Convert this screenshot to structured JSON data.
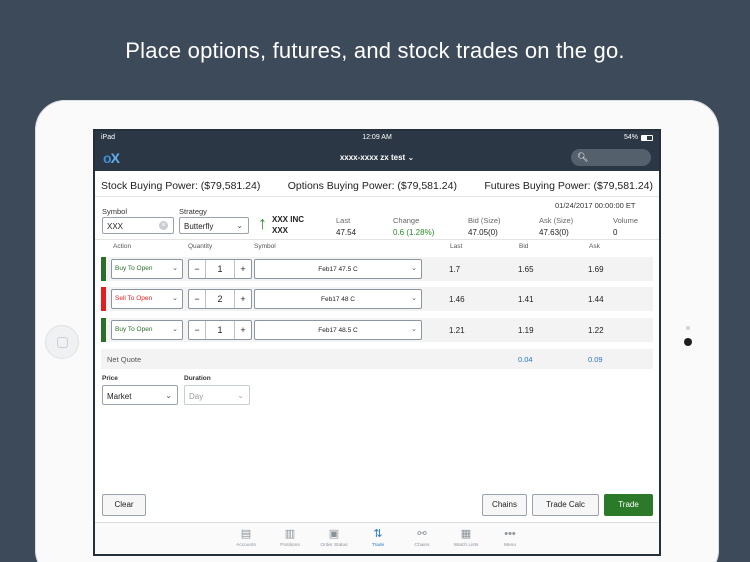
{
  "headline": "Place options, futures, and stock trades on the go.",
  "statusbar": {
    "device": "iPad",
    "time": "12:09 AM",
    "battery": "54%"
  },
  "navbar": {
    "logo_o": "o",
    "logo_x": "X",
    "account": "xxxx-xxxx zx test"
  },
  "buying_power": {
    "stock": "Stock Buying Power: ($79,581.24)",
    "options": "Options Buying Power: ($79,581.24)",
    "futures": "Futures Buying Power: ($79,581.24)"
  },
  "order": {
    "symbol_label": "Symbol",
    "symbol_value": "XXX",
    "strategy_label": "Strategy",
    "strategy_value": "Butterfly"
  },
  "quote": {
    "timestamp": "01/24/2017 00:00:00 ET",
    "name_line1": "XXX INC",
    "name_line2": "XXX",
    "last_label": "Last",
    "last_value": "47.54",
    "change_label": "Change",
    "change_value": "0.6 (1.28%)",
    "bid_label": "Bid (Size)",
    "bid_value": "47.05(0)",
    "ask_label": "Ask (Size)",
    "ask_value": "47.63(0)",
    "volume_label": "Volume",
    "volume_value": "0"
  },
  "legs_header": {
    "action": "Action",
    "quantity": "Quantity",
    "symbol": "Symbol",
    "last": "Last",
    "bid": "Bid",
    "ask": "Ask"
  },
  "legs": [
    {
      "action": "Buy To Open",
      "qty": "1",
      "symbol": "Feb17 47.5 C",
      "last": "1.7",
      "bid": "1.65",
      "ask": "1.69"
    },
    {
      "action": "Sell To Open",
      "qty": "2",
      "symbol": "Feb17 48 C",
      "last": "1.46",
      "bid": "1.41",
      "ask": "1.44"
    },
    {
      "action": "Buy To Open",
      "qty": "1",
      "symbol": "Feb17 48.5 C",
      "last": "1.21",
      "bid": "1.19",
      "ask": "1.22"
    }
  ],
  "colors": {
    "buy": "#2a6e2a",
    "sell": "#e02020",
    "accent": "#2a78c8"
  },
  "net_quote": {
    "label": "Net Quote",
    "bid": "0.04",
    "ask": "0.09"
  },
  "price": {
    "label": "Price",
    "value": "Market"
  },
  "duration": {
    "label": "Duration",
    "value": "Day"
  },
  "buttons": {
    "clear": "Clear",
    "chains": "Chains",
    "trade_calc": "Trade Calc",
    "trade": "Trade"
  },
  "tabs": [
    {
      "label": "Accounts",
      "icon": "accounts-icon"
    },
    {
      "label": "Positions",
      "icon": "positions-icon"
    },
    {
      "label": "Order Status",
      "icon": "order-status-icon"
    },
    {
      "label": "Trade",
      "icon": "trade-icon"
    },
    {
      "label": "Chains",
      "icon": "chains-icon"
    },
    {
      "label": "Watch Lists",
      "icon": "watch-lists-icon"
    },
    {
      "label": "Menu",
      "icon": "menu-icon"
    }
  ]
}
